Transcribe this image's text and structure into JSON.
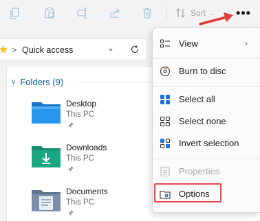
{
  "toolbar": {
    "sort_label": "Sort",
    "more_label": "•••",
    "icons": [
      "copy-icon",
      "paste-icon",
      "rename-icon",
      "share-icon",
      "delete-icon"
    ],
    "annotation_arrow_color": "#e23b3b"
  },
  "address_bar": {
    "current_location": "Quick access",
    "separator": ">"
  },
  "content": {
    "group": {
      "label": "Folders (9)"
    },
    "folders": [
      {
        "name": "Desktop",
        "location": "This PC",
        "icon": "desktop-folder-icon"
      },
      {
        "name": "Downloads",
        "location": "This PC",
        "icon": "downloads-folder-icon"
      },
      {
        "name": "Documents",
        "location": "This PC",
        "icon": "documents-folder-icon"
      }
    ]
  },
  "more_menu": {
    "items": [
      {
        "label": "View",
        "icon": "view-icon",
        "has_submenu": true,
        "enabled": true
      },
      {
        "label": "Burn to disc",
        "icon": "burn-disc-icon",
        "enabled": true
      },
      {
        "label": "Select all",
        "icon": "select-all-icon",
        "enabled": true
      },
      {
        "label": "Select none",
        "icon": "select-none-icon",
        "enabled": true
      },
      {
        "label": "Invert selection",
        "icon": "invert-selection-icon",
        "enabled": true
      },
      {
        "label": "Properties",
        "icon": "properties-icon",
        "enabled": false
      },
      {
        "label": "Options",
        "icon": "options-icon",
        "enabled": true,
        "highlighted": true
      }
    ],
    "highlight_color": "#e5474b"
  }
}
